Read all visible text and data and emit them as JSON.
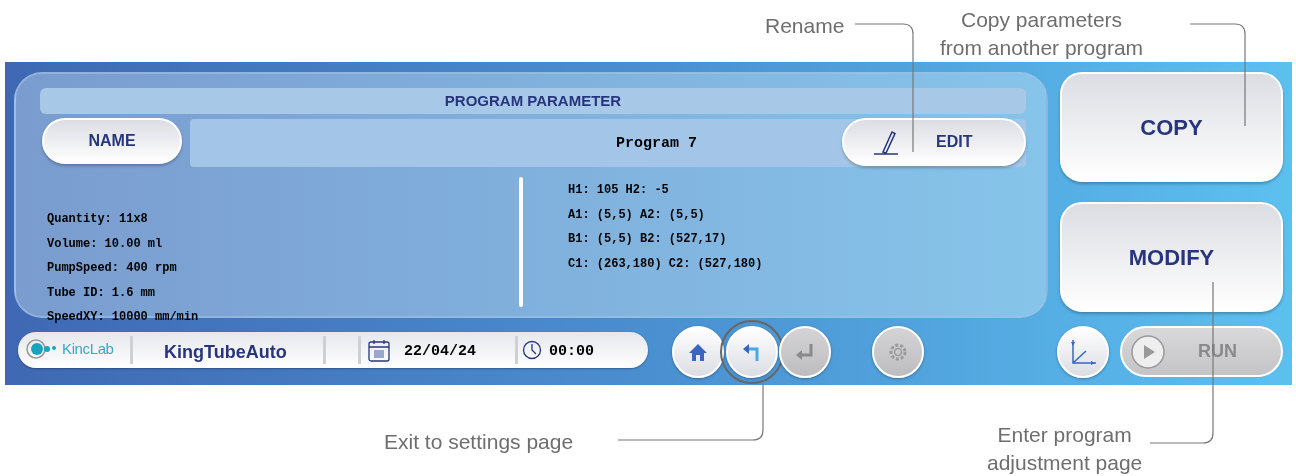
{
  "annotations": [
    {
      "kind": "rename",
      "text": "Rename"
    },
    {
      "kind": "copy",
      "text": "Copy parameters\nfrom another program"
    },
    {
      "kind": "exit",
      "text": "Exit to settings page"
    },
    {
      "kind": "modify",
      "text": "Enter program\nadjustment page"
    }
  ],
  "panel": {
    "title": "PROGRAM PARAMETER",
    "name_button": "NAME",
    "program_name": "Program 7",
    "edit_button": "EDIT",
    "left_lines": [
      "Quantity: 11x8",
      "Volume: 10.00 ml",
      "PumpSpeed: 400 rpm",
      "Tube ID: 1.6 mm",
      "SpeedXY: 10000 mm/min"
    ],
    "right_lines": [
      "H1: 105 H2: -5",
      "A1: (5,5) A2: (5,5)",
      "B1: (5,5) B2: (527,17)",
      "C1: (263,180) C2: (527,180)"
    ]
  },
  "side_buttons": [
    {
      "label": "COPY"
    },
    {
      "label": "MODIFY"
    }
  ],
  "status_bar": {
    "logo": "KincLab",
    "app_name": "KingTubeAuto",
    "date": "22/04/24",
    "time": "00:00"
  },
  "toolbar": [
    {
      "kind": "home",
      "disabled": false,
      "highlighted": false
    },
    {
      "kind": "back",
      "disabled": false,
      "highlighted": true
    },
    {
      "kind": "enter",
      "disabled": true,
      "highlighted": false
    },
    {
      "kind": "settings",
      "disabled": true,
      "highlighted": false
    }
  ],
  "run_button": {
    "label": "RUN",
    "disabled": true
  }
}
